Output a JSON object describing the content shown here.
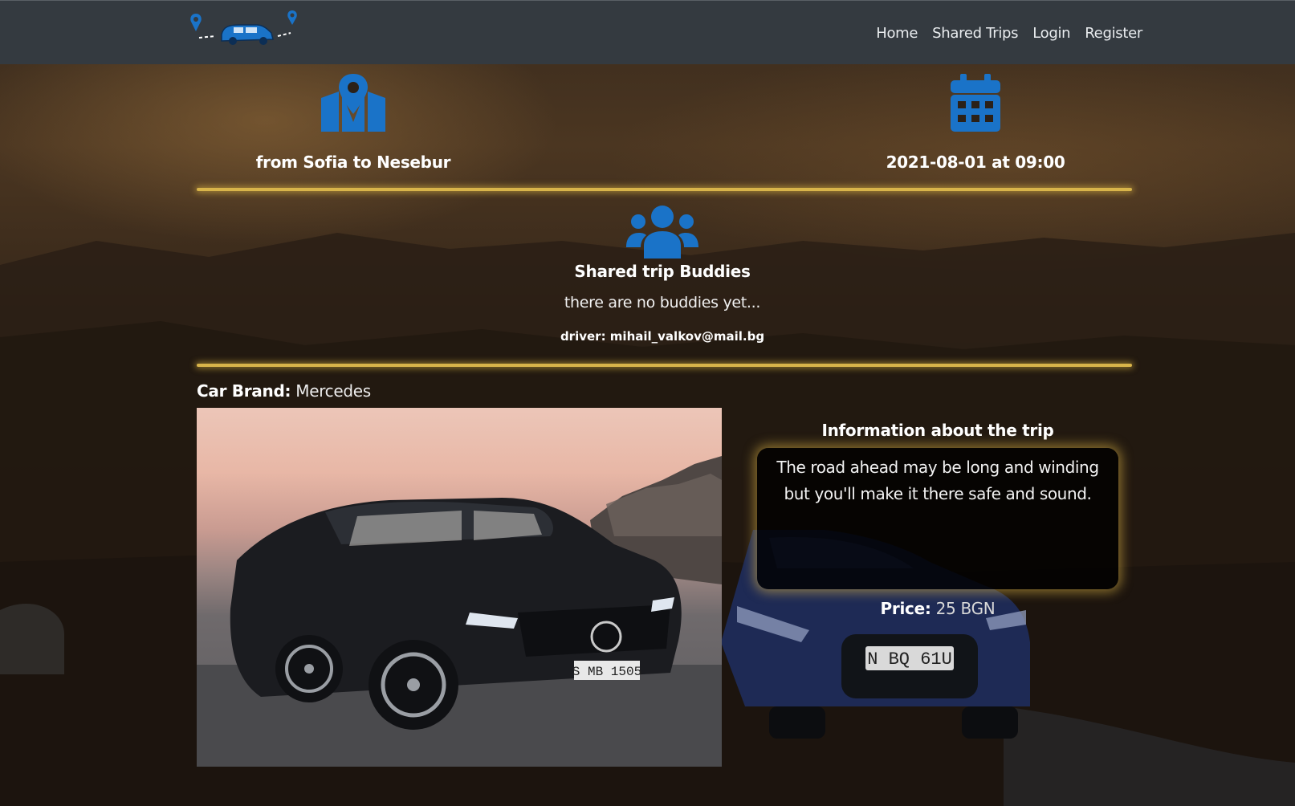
{
  "navbar": {
    "logo": "car-route-logo",
    "links": [
      "Home",
      "Shared Trips",
      "Login",
      "Register"
    ]
  },
  "trip": {
    "route_icon": "map-marker-icon",
    "route_text": "from Sofia to Nesebur",
    "date_icon": "calendar-icon",
    "date_text": "2021-08-01 at 09:00"
  },
  "buddies": {
    "icon": "users-icon",
    "title": "Shared trip Buddies",
    "empty_text": "there are no buddies yet...",
    "driver_label": "driver:",
    "driver_email": "mihail_valkov@mail.bg"
  },
  "car": {
    "brand_label": "Car Brand:",
    "brand_value": "Mercedes",
    "photo_plate": "S MB 1505"
  },
  "info": {
    "title": "Information about the trip",
    "text": "The road ahead may be long and winding but you'll make it there safe and sound.",
    "price_label": "Price:",
    "price_value": "25 BGN"
  },
  "background": {
    "plate": "N BQ 61U"
  },
  "colors": {
    "accent_blue": "#1a73c8",
    "navbar_bg": "#343a40",
    "divider_gold": "#d8b44a"
  }
}
